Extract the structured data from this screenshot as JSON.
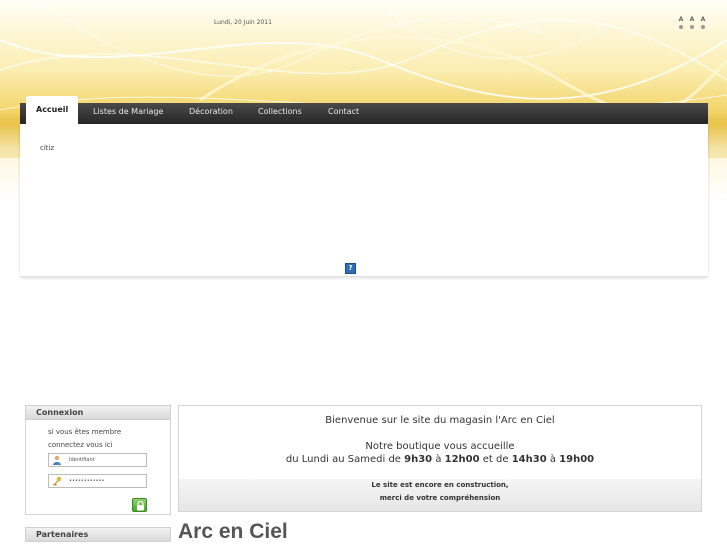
{
  "header": {
    "date": "Lundi, 20 Juin 2011",
    "font_size_controls": [
      "A",
      "A",
      "A"
    ]
  },
  "nav": {
    "items": [
      {
        "label": "Accueil",
        "active": true
      },
      {
        "label": "Listes de Mariage",
        "active": false
      },
      {
        "label": "Décoration",
        "active": false
      },
      {
        "label": "Collections",
        "active": false
      },
      {
        "label": "Contact",
        "active": false
      }
    ]
  },
  "content": {
    "text": "citiz",
    "broken_image_glyph": "?"
  },
  "sidebar": {
    "login": {
      "title": "Connexion",
      "line1": "si vous êtes membre",
      "line2": "connectez vous ici",
      "username_value": "Identifiant",
      "password_value": "••••••••••••"
    },
    "partners_title": "Partenaires"
  },
  "welcome": {
    "line1": "Bienvenue sur le site du magasin l'Arc en Ciel",
    "line2": "Notre boutique vous accueille",
    "hours_prefix": "du Lundi au Samedi de ",
    "h1": "9h30",
    "a1": " à ",
    "h2": "12h00",
    "et": " et de ",
    "h3": "14h30",
    "a2": " à ",
    "h4": "19h00",
    "notice1": "Le site est encore en construction,",
    "notice2": "merci de votre compréhension"
  },
  "page_title": "Arc en Ciel",
  "colors": {
    "wave_yellow": "#f3d56a",
    "nav_dark": "#2f2f2f",
    "accent_green": "#4aa52a"
  }
}
